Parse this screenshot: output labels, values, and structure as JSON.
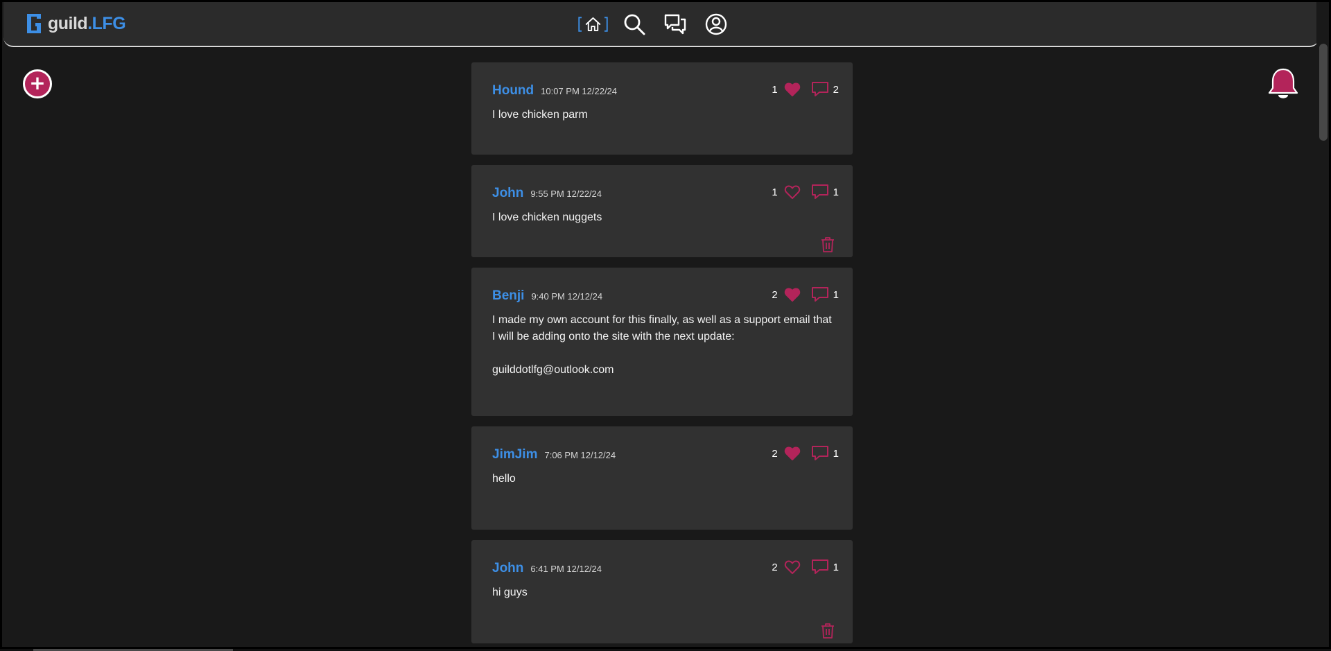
{
  "app": {
    "logo_part1": "guild",
    "logo_part2": ".LFG"
  },
  "colors": {
    "accent_blue": "#3d8fe6",
    "accent_pink": "#b3245a",
    "card": "#313131",
    "background": "#191919"
  },
  "nav": [
    {
      "name": "home",
      "icon": "home-icon",
      "active": true
    },
    {
      "name": "search",
      "icon": "search-icon"
    },
    {
      "name": "messages",
      "icon": "chat-bubbles-icon"
    },
    {
      "name": "profile",
      "icon": "user-circle-icon"
    }
  ],
  "add_button": {
    "icon": "plus-icon",
    "glyph": "+"
  },
  "notifications": {
    "icon": "bell-icon"
  },
  "posts": [
    {
      "author": "Hound",
      "time": "10:07 PM 12/22/24",
      "body": "I love chicken parm",
      "likes": "1",
      "liked": true,
      "comments": "2",
      "deletable": false
    },
    {
      "author": "John",
      "time": "9:55 PM 12/22/24",
      "body": "I love chicken nuggets",
      "likes": "1",
      "liked": false,
      "comments": "1",
      "deletable": true
    },
    {
      "author": "Benji",
      "time": "9:40 PM 12/12/24",
      "body": "I made my own account for this finally, as well as a support email that I will be adding onto the site with the next update:\n\nguilddotlfg@outlook.com",
      "likes": "2",
      "liked": true,
      "comments": "1",
      "deletable": false
    },
    {
      "author": "JimJim",
      "time": "7:06 PM 12/12/24",
      "body": "hello",
      "likes": "2",
      "liked": true,
      "comments": "1",
      "deletable": false
    },
    {
      "author": "John",
      "time": "6:41 PM 12/12/24",
      "body": "hi guys",
      "likes": "2",
      "liked": false,
      "comments": "1",
      "deletable": true
    }
  ]
}
